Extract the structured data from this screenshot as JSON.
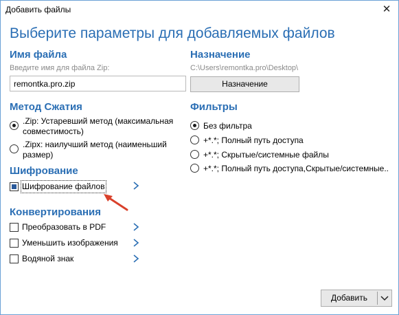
{
  "window": {
    "title": "Добавить файлы",
    "close_glyph": "✕"
  },
  "heading": "Выберите параметры для добавляемых файлов",
  "filename": {
    "title": "Имя файла",
    "hint": "Введите имя для файла Zip:",
    "value": "remontka.pro.zip"
  },
  "destination": {
    "title": "Назначение",
    "path": "C:\\Users\\remontka.pro\\Desktop\\",
    "button_label": "Назначение"
  },
  "compression": {
    "title": "Метод Сжатия",
    "options": [
      {
        "label_line1": ".Zip: Устаревший метод (максимальная",
        "label_line2": "совместимость)",
        "checked": true
      },
      {
        "label_line1": ".Zipx: наилучший метод (наименьший",
        "label_line2": "размер)",
        "checked": false
      }
    ]
  },
  "filters": {
    "title": "Фильтры",
    "options": [
      {
        "label": "Без фильтра",
        "checked": true
      },
      {
        "label": "+*.*; Полный путь доступа",
        "checked": false
      },
      {
        "label": "+*.*; Скрытые/системные файлы",
        "checked": false
      },
      {
        "label": "+*.*; Полный путь доступа,Скрытые/системные..",
        "checked": false
      }
    ]
  },
  "encryption": {
    "title": "Шифрование",
    "option": {
      "label": "Шифрование файлов",
      "checked": true
    }
  },
  "conversions": {
    "title": "Конвертирования",
    "options": [
      {
        "label": "Преобразовать в PDF",
        "checked": false
      },
      {
        "label": "Уменьшить изображения",
        "checked": false
      },
      {
        "label": "Водяной знак",
        "checked": false
      }
    ]
  },
  "add_button": {
    "label": "Добавить"
  },
  "colors": {
    "accent": "#2a6eb4",
    "annotation_arrow": "#d9412b"
  },
  "icons": [
    "close-icon",
    "chevron-right-icon",
    "chevron-down-icon",
    "annotation-arrow-icon"
  ]
}
